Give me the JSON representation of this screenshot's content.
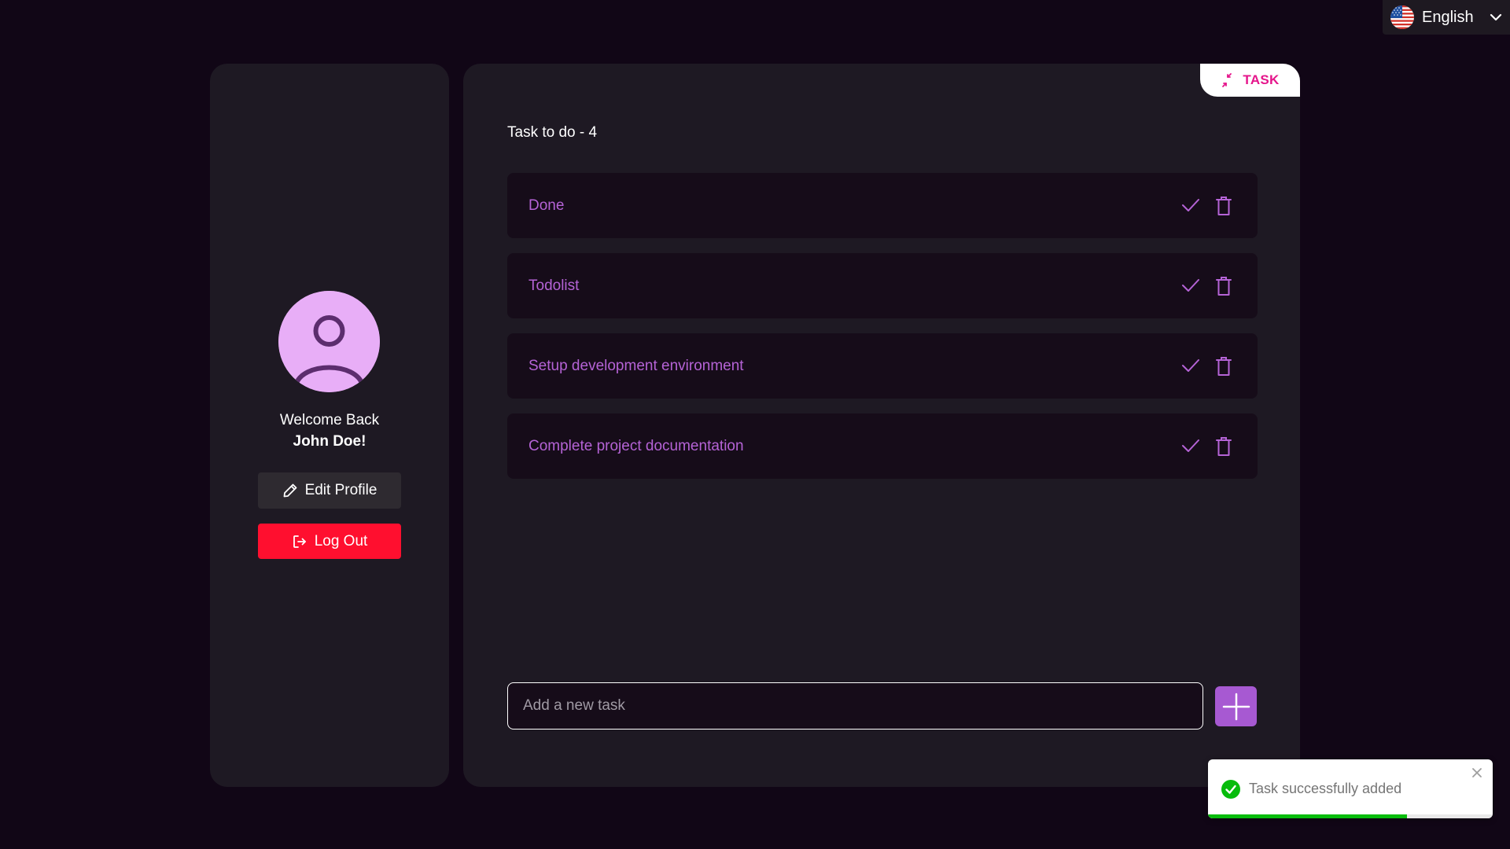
{
  "language": {
    "label": "English",
    "flag_icon": "us-flag-icon"
  },
  "profile": {
    "welcome": "Welcome Back",
    "username": "John Doe!",
    "edit_label": "Edit Profile",
    "logout_label": "Log Out",
    "avatar_color": "#e8aef7",
    "logout_color": "#ff0f2f"
  },
  "panel": {
    "tab_label": "TASK",
    "task_count_label": "Task to do - 4",
    "tasks": [
      {
        "text": "Done"
      },
      {
        "text": "Todolist"
      },
      {
        "text": "Setup development environment"
      },
      {
        "text": "Complete project documentation"
      }
    ],
    "input_placeholder": "Add a new task",
    "accent_color": "#a759d2",
    "task_text_color": "#b563d6"
  },
  "toast": {
    "message": "Task successfully added",
    "status": "success",
    "progress": 0.7
  }
}
